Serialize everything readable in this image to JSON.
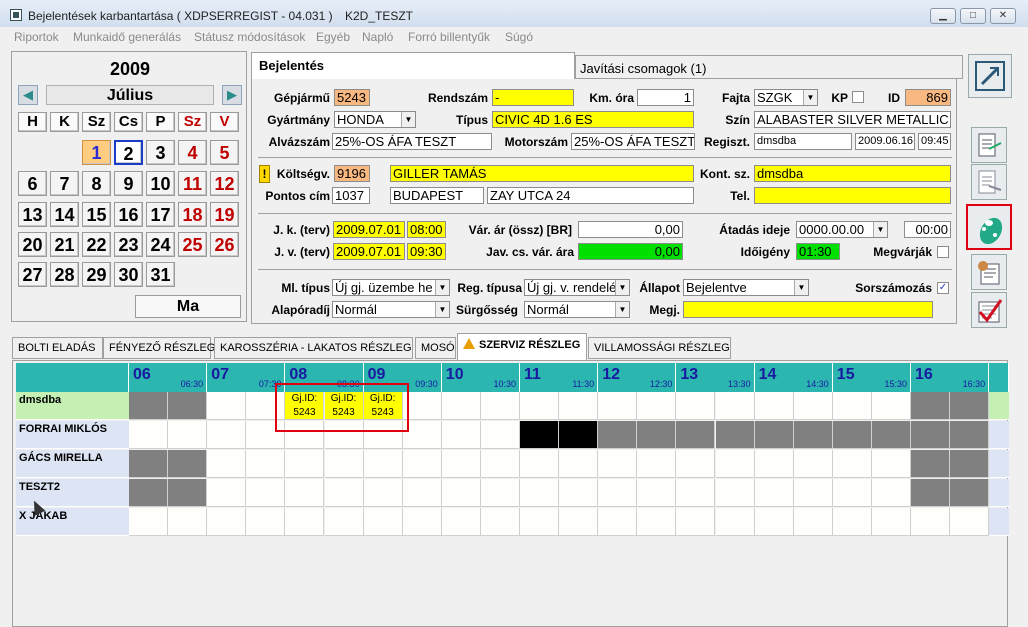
{
  "window": {
    "title": "Bejelentések karbantartása ( XDPSERREGIST - 04.031 )",
    "subtitle": "K2D_TESZT",
    "min": "▁",
    "max": "□",
    "close": "✕"
  },
  "menu": [
    "Riportok",
    "Munkaidő generálás",
    "Státusz módosítások",
    "Egyéb",
    "Napló",
    "Forró billentyűk",
    "Súgó"
  ],
  "calendar": {
    "year": "2009",
    "month": "Július",
    "prev": "◀",
    "next": "▶",
    "weekdays": [
      "H",
      "K",
      "Sz",
      "Cs",
      "P",
      "Sz",
      "V"
    ],
    "days": [
      [
        "",
        "",
        "",
        "",
        "",
        "",
        "",
        ""
      ],
      [
        "",
        "",
        "",
        ""
      ],
      [
        "1",
        "2",
        "3",
        "4",
        "5"
      ],
      [
        "6",
        "7",
        "8",
        "9",
        "10",
        "11",
        "12"
      ],
      [
        "13",
        "14",
        "15",
        "16",
        "17",
        "18",
        "19"
      ],
      [
        "20",
        "21",
        "22",
        "23",
        "24",
        "25",
        "26"
      ],
      [
        "27",
        "28",
        "29",
        "30",
        "31"
      ]
    ],
    "ma": "Ma"
  },
  "tabs": {
    "active": "Bejelentés",
    "other": "Javítási csomagok (1)"
  },
  "form": {
    "gepjarmu_lbl": "Gépjármű",
    "gepjarmu": "5243",
    "rendszam_lbl": "Rendszám",
    "rendszam": "-",
    "km_lbl": "Km. óra",
    "km": "1",
    "fajta_lbl": "Fajta",
    "fajta": "SZGK",
    "kp_lbl": "KP",
    "id_lbl": "ID",
    "id": "869",
    "gyartmany_lbl": "Gyártmány",
    "gyartmany": "HONDA",
    "tipus_lbl": "Típus",
    "tipus": "CIVIC 4D 1.6 ES",
    "szin_lbl": "Szín",
    "szin": "ALABASTER SILVER METALLIC",
    "alvaz_lbl": "Alvázszám",
    "alvaz": "25%-OS ÁFA TESZT",
    "motor_lbl": "Motorszám",
    "motor": "25%-OS ÁFA TESZT",
    "regiszt_lbl": "Regiszt.",
    "regiszt": "dmsdba",
    "regdate": "2009.06.16",
    "regtime": "09:45",
    "warn": "!",
    "koltseg_lbl": "Költségv.",
    "koltseg": "9196",
    "koltseg_nev": "GILLER TAMÁS",
    "kont_lbl": "Kont. sz.",
    "kont": "dmsdba",
    "pontos_lbl": "Pontos cím",
    "irsz": "1037",
    "varos": "BUDAPEST",
    "utca": "ZAY UTCA 24",
    "tel_lbl": "Tel.",
    "tel": "",
    "jk_lbl": "J. k. (terv)",
    "jk_date": "2009.07.01",
    "jk_time": "08:00",
    "var_ar_lbl": "Vár. ár (össz) [BR]",
    "var_ar": "0,00",
    "atadas_lbl": "Átadás ideje",
    "atadas": "0000.00.00",
    "atadas_time": "00:00",
    "jv_lbl": "J. v. (terv)",
    "jv_date": "2009.07.01",
    "jv_time": "09:30",
    "jav_lbl": "Jav. cs. vár. ára",
    "jav": "0,00",
    "ido_lbl": "Időigény",
    "ido": "01:30",
    "megvar_lbl": "Megvárják",
    "mltipus_lbl": "Ml. típus",
    "mltipus": "Új gj. üzembe he",
    "regtipus_lbl": "Reg. típusa",
    "regtipus": "Új gj. v. rendelé",
    "allapot_lbl": "Állapot",
    "allapot": "Bejelentve",
    "sorsz_lbl": "Sorszámozás",
    "sorsz_check": "✓",
    "alapora_lbl": "Alapóradíj",
    "alapora": "Normál",
    "surg_lbl": "Sürgősség",
    "surg": "Normál",
    "megj_lbl": "Megj.",
    "megj": ""
  },
  "subtabs": [
    "BOLTI ELADÁS",
    "FÉNYEZŐ RÉSZLEG",
    "KAROSSZÉRIA - LAKATOS RÉSZLEG",
    "MOSÓ",
    "SZERVIZ RÉSZLEG",
    "VILLAMOSSÁGI RÉSZLEG"
  ],
  "schedule": {
    "hours": [
      "06",
      "07",
      "08",
      "09",
      "10",
      "11",
      "12",
      "13",
      "14",
      "15",
      "16"
    ],
    "halves": [
      "06:30",
      "07:30",
      "08:30",
      "09:30",
      "10:30",
      "11:30",
      "12:30",
      "13:30",
      "14:30",
      "15:30",
      "16:30"
    ],
    "rows": [
      "dmsdba",
      "FORRAI MIKLÓS",
      "GÁCS MIRELLA",
      "TESZT2",
      "X JAKAB"
    ],
    "job_label": "Gj.ID:",
    "job_id": "5243"
  },
  "colors": {
    "accent": "#2bb6b0",
    "highlight": "#ffff00",
    "gray_slot": "#808080",
    "red_box": "#e00010"
  }
}
